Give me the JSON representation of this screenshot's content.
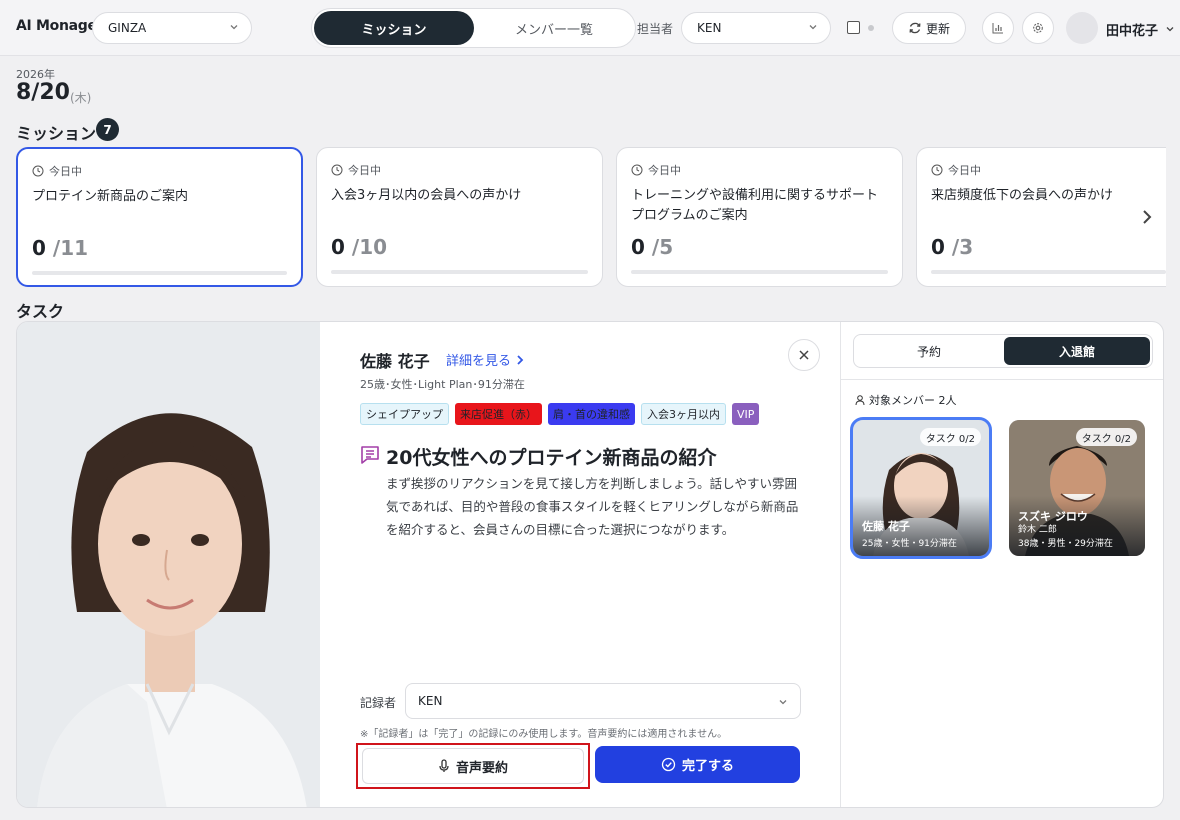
{
  "header": {
    "app_name": "AI Monager",
    "store": "GINZA",
    "tabs": [
      "ミッション",
      "メンバー一覧"
    ],
    "assignee_label": "担当者",
    "assignee": "KEN",
    "refresh_label": "更新",
    "user_name": "田中花子"
  },
  "date": {
    "year": "2026年",
    "day": "8/20",
    "weekday": "(木)"
  },
  "missions": {
    "title": "ミッション",
    "count": "7",
    "items": [
      {
        "status": "今日中",
        "name": "プロテイン新商品のご案内",
        "done": "0",
        "total": "/11",
        "progress": 0
      },
      {
        "status": "今日中",
        "name": "入会3ヶ月以内の会員への声かけ",
        "done": "0",
        "total": "/10",
        "progress": 0
      },
      {
        "status": "今日中",
        "name": "トレーニングや設備利用に関するサポートプログラムのご案内",
        "done": "0",
        "total": "/5",
        "progress": 0
      },
      {
        "status": "今日中",
        "name": "来店頻度低下の会員への声かけ",
        "done": "0",
        "total": "/3",
        "progress": 0
      }
    ]
  },
  "task": {
    "title": "タスク",
    "member_name": "佐藤 花子",
    "detail_link": "詳細を見る",
    "member_meta": "25歳･女性･Light Plan･91分滞在",
    "tags": [
      "シェイプアップ",
      "来店促進（赤）",
      "肩・首の違和感",
      "入会3ヶ月以内",
      "VIP"
    ],
    "heading": "20代女性へのプロテイン新商品の紹介",
    "description": "まず挨拶のリアクションを見て接し方を判断しましょう。話しやすい雰囲気であれば、目的や普段の食事スタイルを軽くヒアリングしながら新商品を紹介すると、会員さんの目標に合った選択につながります。",
    "recorder_label": "記録者",
    "recorder": "KEN",
    "recorder_note": "※「記録者」は「完了」の記録にのみ使用します。音声要約には適用されません。",
    "voice_button": "音声要約",
    "done_button": "完了する"
  },
  "side": {
    "tabs": [
      "予約",
      "入退館"
    ],
    "target_label": "対象メンバー 2人",
    "members": [
      {
        "badge": "タスク 0/2",
        "name": "佐藤 花子",
        "sub": "25歳・女性・91分滞在"
      },
      {
        "badge": "タスク 0/2",
        "name": "スズキ ジロウ",
        "name_kanji": "鈴木 二郎",
        "sub": "38歳・男性・29分滞在"
      }
    ]
  },
  "colors": {
    "accent": "#3358e6",
    "primary_button": "#2240e0",
    "dark": "#1f2a33",
    "highlight_outline": "#d0141b"
  }
}
